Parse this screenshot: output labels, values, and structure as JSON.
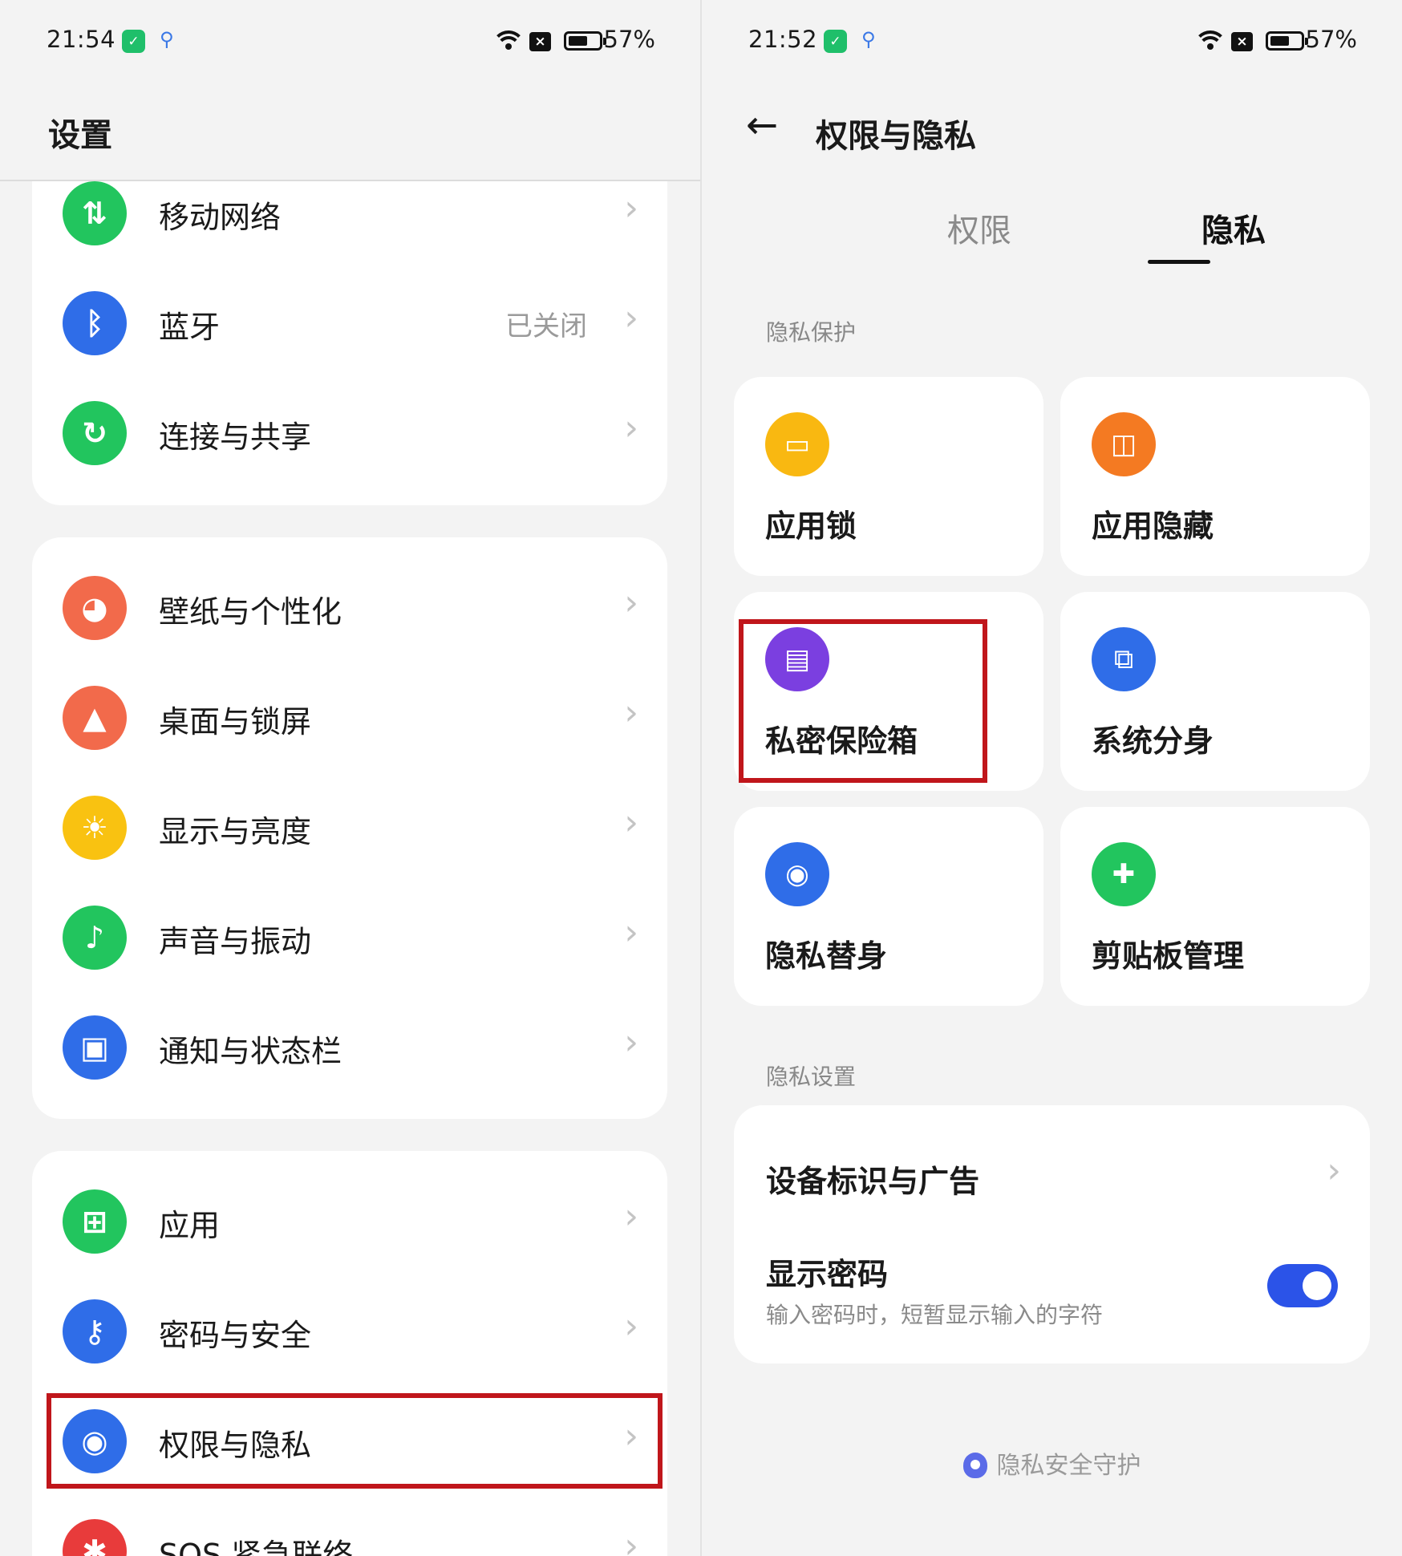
{
  "left": {
    "status": {
      "time": "21:54",
      "battery": "57%"
    },
    "title": "设置",
    "groups": [
      [
        {
          "label": "移动网络",
          "value": "",
          "icon": "mobile-network-icon",
          "color": "#22c55e",
          "glyph": "⇅"
        },
        {
          "label": "蓝牙",
          "value": "已关闭",
          "icon": "bluetooth-icon",
          "color": "#2f6de8",
          "glyph": "ᛒ"
        },
        {
          "label": "连接与共享",
          "value": "",
          "icon": "share-icon",
          "color": "#22c55e",
          "glyph": "↻"
        }
      ],
      [
        {
          "label": "壁纸与个性化",
          "value": "",
          "icon": "palette-icon",
          "color": "#f26a4b",
          "glyph": "◕"
        },
        {
          "label": "桌面与锁屏",
          "value": "",
          "icon": "picture-icon",
          "color": "#f26a4b",
          "glyph": "▲"
        },
        {
          "label": "显示与亮度",
          "value": "",
          "icon": "sun-icon",
          "color": "#f9c211",
          "glyph": "☀"
        },
        {
          "label": "声音与振动",
          "value": "",
          "icon": "bell-icon",
          "color": "#22c55e",
          "glyph": "♪"
        },
        {
          "label": "通知与状态栏",
          "value": "",
          "icon": "notification-icon",
          "color": "#2f6de8",
          "glyph": "▣"
        }
      ],
      [
        {
          "label": "应用",
          "value": "",
          "icon": "apps-icon",
          "color": "#22c55e",
          "glyph": "⊞"
        },
        {
          "label": "密码与安全",
          "value": "",
          "icon": "key-icon",
          "color": "#2f6de8",
          "glyph": "⚷"
        },
        {
          "label": "权限与隐私",
          "value": "",
          "icon": "privacy-eye-icon",
          "color": "#2f6de8",
          "glyph": "◉"
        },
        {
          "label": "SOS 紧急联络",
          "value": "",
          "icon": "sos-icon",
          "color": "#e83b3b",
          "glyph": "✱"
        }
      ]
    ]
  },
  "right": {
    "status": {
      "time": "21:52",
      "battery": "57%"
    },
    "back_glyph": "←",
    "title": "权限与隐私",
    "tabs": [
      "权限",
      "隐私"
    ],
    "section_protect": "隐私保护",
    "tiles": [
      {
        "label": "应用锁",
        "icon": "app-lock-icon",
        "color": "#f9b811",
        "glyph": "🔒"
      },
      {
        "label": "应用隐藏",
        "icon": "app-hide-icon",
        "color": "#f47a22",
        "glyph": "◫"
      },
      {
        "label": "私密保险箱",
        "icon": "safe-box-icon",
        "color": "#7b3fe0",
        "glyph": "▤"
      },
      {
        "label": "系统分身",
        "icon": "clone-icon",
        "color": "#2f6de8",
        "glyph": "⧉"
      },
      {
        "label": "隐私替身",
        "icon": "eye-lock-icon",
        "color": "#2f6de8",
        "glyph": "◉"
      },
      {
        "label": "剪贴板管理",
        "icon": "clipboard-icon",
        "color": "#22c55e",
        "glyph": "✚"
      }
    ],
    "section_settings": "隐私设置",
    "device_id": "设备标识与广告",
    "show_password": "显示密码",
    "show_password_desc": "输入密码时，短暂显示输入的字符",
    "show_password_on": true,
    "footer": "隐私安全守护"
  }
}
